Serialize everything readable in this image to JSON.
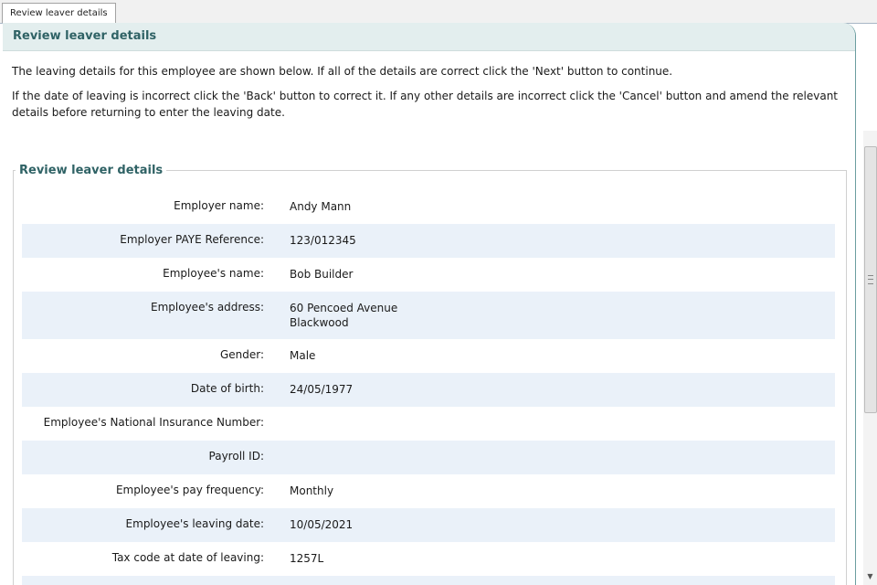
{
  "tab": {
    "label": "Review leaver details"
  },
  "header": {
    "title": "Review leaver details"
  },
  "intro": {
    "line1": "The leaving details for this employee are shown below. If all of the details are correct click the 'Next' button to continue.",
    "line2": "If the date of leaving is incorrect click the 'Back' button to correct it. If any other details are incorrect click the 'Cancel' button and amend the relevant details before returning to enter the leaving date."
  },
  "section": {
    "legend": "Review leaver details"
  },
  "rows": [
    {
      "label": "Employer name:",
      "value": "Andy Mann"
    },
    {
      "label": "Employer PAYE Reference:",
      "value": "123/012345"
    },
    {
      "label": "Employee's name:",
      "value": "Bob Builder"
    },
    {
      "label": "Employee's address:",
      "value_line1": "60 Pencoed Avenue",
      "value_line2": "Blackwood"
    },
    {
      "label": "Gender:",
      "value": "Male"
    },
    {
      "label": "Date of birth:",
      "value": "24/05/1977"
    },
    {
      "label": "Employee's National Insurance Number:",
      "value": ""
    },
    {
      "label": "Payroll ID:",
      "value": ""
    },
    {
      "label": "Employee's pay frequency:",
      "value": "Monthly"
    },
    {
      "label": "Employee's leaving date:",
      "value": "10/05/2021"
    },
    {
      "label": "Tax code at date of leaving:",
      "value": "1257L"
    }
  ],
  "scrollbar": {
    "grip_icon": "scroll-grip-icon",
    "down_icon": "scroll-down-arrow-icon"
  }
}
